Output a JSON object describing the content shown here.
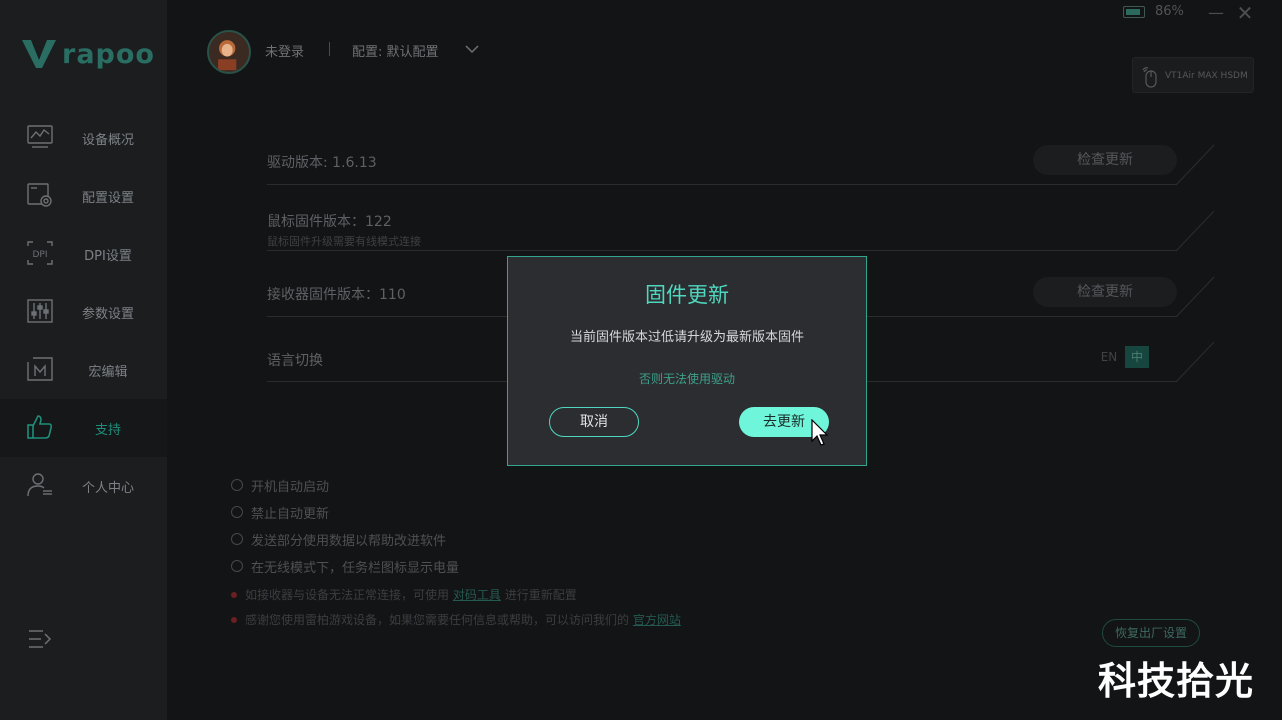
{
  "brand": {
    "logo_text": "rapoo",
    "accent": "#1f8e79"
  },
  "sidebar": {
    "items": [
      {
        "label": "设备概况",
        "icon": "chart-monitor-icon",
        "active": false
      },
      {
        "label": "配置设置",
        "icon": "settings-screen-icon",
        "active": false
      },
      {
        "label": "DPI设置",
        "icon": "dpi-icon",
        "active": false
      },
      {
        "label": "参数设置",
        "icon": "sliders-icon",
        "active": false
      },
      {
        "label": "宏编辑",
        "icon": "macro-icon",
        "active": false
      },
      {
        "label": "支持",
        "icon": "thumbs-up-icon",
        "active": true
      },
      {
        "label": "个人中心",
        "icon": "user-icon",
        "active": false
      }
    ],
    "collapse_icon": "collapse-menu-icon"
  },
  "header": {
    "user_name": "未登录",
    "profile_label": "配置: 默认配置",
    "battery_percent": "86%",
    "battery_level": 0.86,
    "device_name": "VT1Air MAX HSDM"
  },
  "support": {
    "driver_version": "驱动版本: 1.6.13",
    "mouse_firmware": "鼠标固件版本：122",
    "mouse_firmware_hint": "鼠标固件升级需要有线模式连接",
    "receiver_firmware": "接收器固件版本：110",
    "language_label": "语言切换",
    "check_update_label": "检查更新",
    "lang_en": "EN",
    "lang_zh": "中",
    "options": [
      "开机自动启动",
      "禁止自动更新",
      "发送部分使用数据以帮助改进软件",
      "在无线模式下，任务栏图标显示电量"
    ],
    "note1_prefix": "如接收器与设备无法正常连接，可使用",
    "note1_link": "对码工具",
    "note1_suffix": "进行重新配置",
    "note2_prefix": "感谢您使用雷柏游戏设备，如果您需要任何信息或帮助，可以访问我们的",
    "note2_link": "官方网站",
    "reset_label": "恢复出厂设置"
  },
  "dialog": {
    "title": "固件更新",
    "message": "当前固件版本过低请升级为最新版本固件",
    "sub_message": "否则无法使用驱动",
    "cancel_label": "取消",
    "confirm_label": "去更新"
  },
  "watermark": "科技拾光"
}
